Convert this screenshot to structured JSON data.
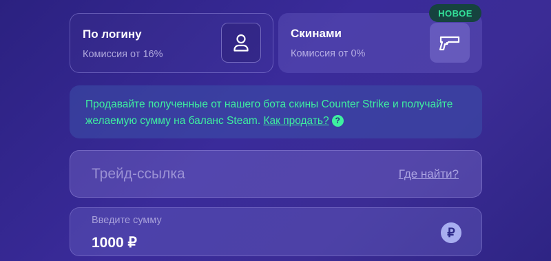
{
  "methods": [
    {
      "title": "По логину",
      "commission": "Комиссия от 16%",
      "icon": "user-icon"
    },
    {
      "title": "Скинами",
      "commission": "Комиссия от 0%",
      "icon": "gun-icon",
      "badge": "НОВОЕ"
    }
  ],
  "info": {
    "text": "Продавайте полученные от нашего бота скины Counter Strike и получайте желаемую сумму на баланс Steam.",
    "link": "Как продать?",
    "help_symbol": "?"
  },
  "trade_link": {
    "placeholder": "Трейд-ссылка",
    "help_link": "Где найти?"
  },
  "amount": {
    "label": "Введите сумму",
    "value": "1000 ₽",
    "currency_symbol": "₽"
  },
  "colors": {
    "accent_green": "#3ef0a0",
    "badge_bg": "#16433f"
  }
}
